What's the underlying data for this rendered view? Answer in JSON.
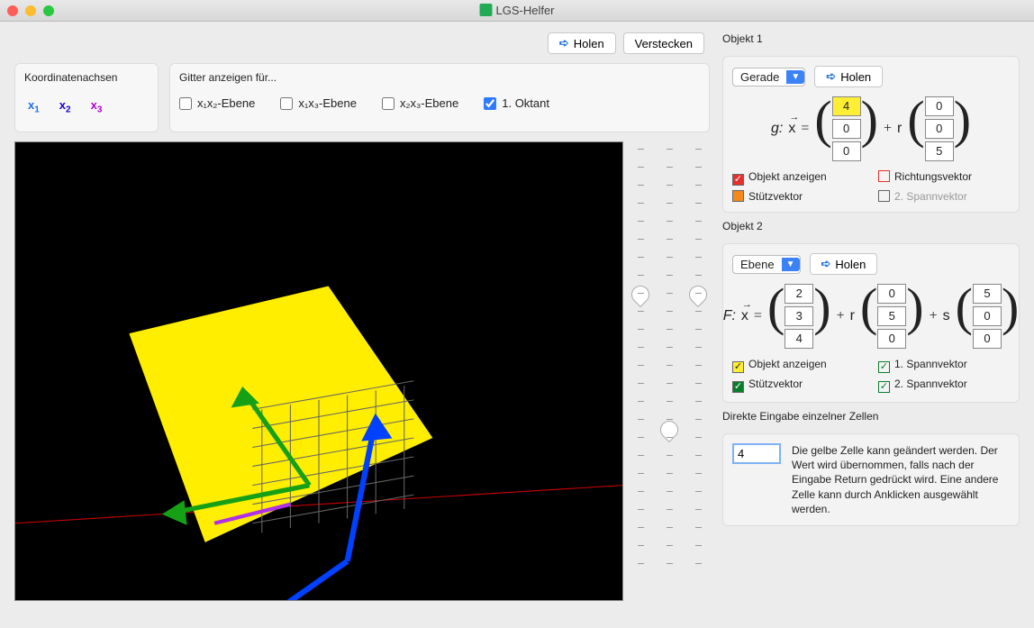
{
  "window": {
    "title": "LGS-Helfer"
  },
  "toolbar": {
    "holen": "Holen",
    "verstecken": "Verstecken"
  },
  "axes": {
    "label": "Koordinatenachsen",
    "x1": "x",
    "x2": "x",
    "x3": "x"
  },
  "grid": {
    "label": "Gitter anzeigen für...",
    "x1x2": "x₁x₂-Ebene",
    "x1x3": "x₁x₃-Ebene",
    "x2x3": "x₂x₃-Ebene",
    "oktant": "1. Oktant"
  },
  "obj1": {
    "title": "Objekt 1",
    "type": "Gerade",
    "holen": "Holen",
    "prefix": "g:",
    "support": [
      "4",
      "0",
      "0"
    ],
    "dir": [
      "0",
      "0",
      "5"
    ],
    "param": "r",
    "chk_show": "Objekt anzeigen",
    "chk_dir": "Richtungsvektor",
    "chk_support": "Stützvektor",
    "chk_span2": "2. Spannvektor"
  },
  "obj2": {
    "title": "Objekt 2",
    "type": "Ebene",
    "holen": "Holen",
    "prefix": "F:",
    "support": [
      "2",
      "3",
      "4"
    ],
    "span1": [
      "0",
      "5",
      "0"
    ],
    "span2": [
      "5",
      "0",
      "0"
    ],
    "p1": "r",
    "p2": "s",
    "chk_show": "Objekt anzeigen",
    "chk_span1": "1. Spannvektor",
    "chk_support": "Stützvektor",
    "chk_span2": "2. Spannvektor"
  },
  "direct": {
    "title": "Direkte Eingabe einzelner Zellen",
    "value": "4",
    "help": "Die gelbe Zelle kann geändert werden. Der Wert wird übernommen, falls nach der Eingabe Return gedrückt wird. Eine andere Zelle kann durch Anklicken ausgewählt werden."
  }
}
